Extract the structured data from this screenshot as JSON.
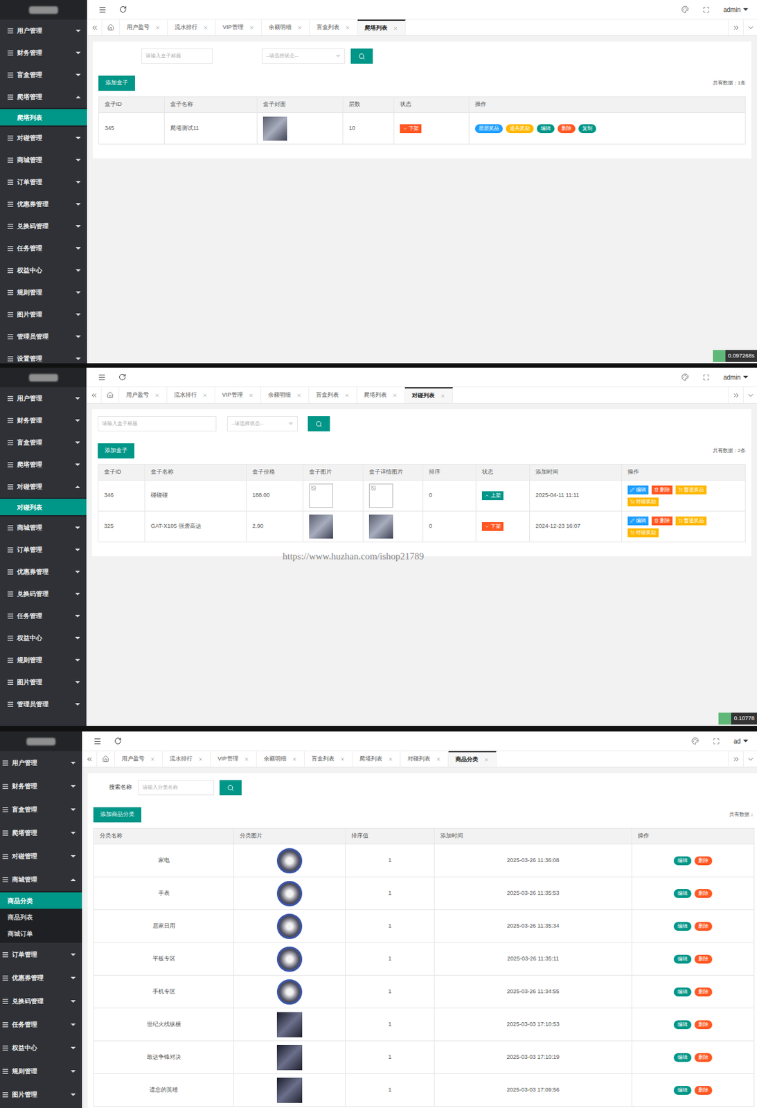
{
  "panels": [
    {
      "user": "admin",
      "sidebar": [
        {
          "label": "用户管理",
          "expanded": false,
          "children": []
        },
        {
          "label": "财务管理",
          "expanded": false,
          "children": []
        },
        {
          "label": "盲盒管理",
          "expanded": false,
          "children": []
        },
        {
          "label": "爬塔管理",
          "expanded": true,
          "children": [
            {
              "label": "爬塔列表",
              "selected": true
            }
          ]
        },
        {
          "label": "对碰管理",
          "expanded": false,
          "children": []
        },
        {
          "label": "商城管理",
          "expanded": false,
          "children": []
        },
        {
          "label": "订单管理",
          "expanded": false,
          "children": []
        },
        {
          "label": "优惠券管理",
          "expanded": false,
          "children": []
        },
        {
          "label": "兑换码管理",
          "expanded": false,
          "children": []
        },
        {
          "label": "任务管理",
          "expanded": false,
          "children": []
        },
        {
          "label": "权益中心",
          "expanded": false,
          "children": []
        },
        {
          "label": "规则管理",
          "expanded": false,
          "children": []
        },
        {
          "label": "图片管理",
          "expanded": false,
          "children": []
        },
        {
          "label": "管理员管理",
          "expanded": false,
          "children": []
        },
        {
          "label": "设置管理",
          "expanded": false,
          "children": []
        }
      ],
      "tabs": [
        {
          "label": "用户盈亏",
          "selected": false
        },
        {
          "label": "流水排行",
          "selected": false
        },
        {
          "label": "VIP管理",
          "selected": false
        },
        {
          "label": "余额明细",
          "selected": false
        },
        {
          "label": "盲盒列表",
          "selected": false
        },
        {
          "label": "爬塔列表",
          "selected": true
        }
      ],
      "search": {
        "label": "",
        "placeholder": "请输入盒子标题"
      },
      "select": {
        "placeholder": "--请选择状态--"
      },
      "add_button": "添加盒子",
      "count": "共有数据：1条",
      "table": {
        "columns": [
          "盒子ID",
          "盒子名称",
          "盒子封面",
          "层数",
          "状态",
          "操作"
        ],
        "rows": [
          {
            "cells": [
              {
                "kind": "text",
                "text": "345"
              },
              {
                "kind": "text",
                "text": "爬塔测试11"
              },
              {
                "kind": "image",
                "image": "photo"
              },
              {
                "kind": "text",
                "text": "10"
              },
              {
                "kind": "status",
                "label": "下架",
                "on": false
              },
              {
                "kind": "actions",
                "actions": [
                  {
                    "label": "层层奖品",
                    "kind": "pill",
                    "color": "#1e9fff"
                  },
                  {
                    "label": "通关奖励",
                    "kind": "pill",
                    "color": "#ffb800"
                  },
                  {
                    "label": "编辑",
                    "kind": "pill",
                    "color": "#009688"
                  },
                  {
                    "label": "删除",
                    "kind": "pill",
                    "color": "#ff5722"
                  },
                  {
                    "label": "复制",
                    "kind": "pill",
                    "color": "#009688"
                  }
                ]
              }
            ]
          }
        ]
      },
      "watermark": "",
      "timer": "0.097268s"
    },
    {
      "user": "admin",
      "sidebar": [
        {
          "label": "用户管理",
          "expanded": false,
          "children": []
        },
        {
          "label": "财务管理",
          "expanded": false,
          "children": []
        },
        {
          "label": "盲盒管理",
          "expanded": false,
          "children": []
        },
        {
          "label": "爬塔管理",
          "expanded": false,
          "children": []
        },
        {
          "label": "对碰管理",
          "expanded": true,
          "children": [
            {
              "label": "对碰列表",
              "selected": true
            }
          ]
        },
        {
          "label": "商城管理",
          "expanded": false,
          "children": []
        },
        {
          "label": "订单管理",
          "expanded": false,
          "children": []
        },
        {
          "label": "优惠券管理",
          "expanded": false,
          "children": []
        },
        {
          "label": "兑换码管理",
          "expanded": false,
          "children": []
        },
        {
          "label": "任务管理",
          "expanded": false,
          "children": []
        },
        {
          "label": "权益中心",
          "expanded": false,
          "children": []
        },
        {
          "label": "规则管理",
          "expanded": false,
          "children": []
        },
        {
          "label": "图片管理",
          "expanded": false,
          "children": []
        },
        {
          "label": "管理员管理",
          "expanded": false,
          "children": []
        }
      ],
      "tabs": [
        {
          "label": "用户盈亏",
          "selected": false
        },
        {
          "label": "流水排行",
          "selected": false
        },
        {
          "label": "VIP管理",
          "selected": false
        },
        {
          "label": "余额明细",
          "selected": false
        },
        {
          "label": "盲盒列表",
          "selected": false
        },
        {
          "label": "爬塔列表",
          "selected": false
        },
        {
          "label": "对碰列表",
          "selected": true
        }
      ],
      "search": {
        "label": "",
        "placeholder": "请输入盒子标题"
      },
      "select": {
        "placeholder": "--请选择状态--"
      },
      "add_button": "添加盒子",
      "count": "共有数据：2条",
      "table": {
        "columns": [
          "盒子ID",
          "盒子名称",
          "盒子价格",
          "盒子图片",
          "盒子详情图片",
          "排序",
          "状态",
          "添加时间",
          "操作"
        ],
        "rows": [
          {
            "cells": [
              {
                "kind": "text",
                "text": "346"
              },
              {
                "kind": "text",
                "text": "碰碰碰"
              },
              {
                "kind": "text",
                "text": "188.00"
              },
              {
                "kind": "image",
                "image": "broken"
              },
              {
                "kind": "image",
                "image": "broken"
              },
              {
                "kind": "text",
                "text": "0"
              },
              {
                "kind": "status",
                "label": "上架",
                "on": true
              },
              {
                "kind": "text",
                "text": "2025-04-11 11:11"
              },
              {
                "kind": "actions",
                "actions": [
                  {
                    "label": "编辑",
                    "kind": "edit",
                    "color": "#1e9fff"
                  },
                  {
                    "label": "删除",
                    "kind": "delete",
                    "color": "#ff5722"
                  },
                  {
                    "label": "普通奖品",
                    "kind": "prize",
                    "color": "#ffb800"
                  },
                  {
                    "label": "对碰奖励",
                    "kind": "prize",
                    "color": "#ffb800"
                  }
                ]
              }
            ]
          },
          {
            "cells": [
              {
                "kind": "text",
                "text": "325"
              },
              {
                "kind": "text",
                "text": "GAT-X105 强袭高达"
              },
              {
                "kind": "text",
                "text": "2.90"
              },
              {
                "kind": "image",
                "image": "photo"
              },
              {
                "kind": "image",
                "image": "photo"
              },
              {
                "kind": "text",
                "text": "0"
              },
              {
                "kind": "status",
                "label": "下架",
                "on": false
              },
              {
                "kind": "text",
                "text": "2024-12-23 16:07"
              },
              {
                "kind": "actions",
                "actions": [
                  {
                    "label": "编辑",
                    "kind": "edit",
                    "color": "#1e9fff"
                  },
                  {
                    "label": "删除",
                    "kind": "delete",
                    "color": "#ff5722"
                  },
                  {
                    "label": "普通奖品",
                    "kind": "prize",
                    "color": "#ffb800"
                  },
                  {
                    "label": "对碰奖励",
                    "kind": "prize",
                    "color": "#ffb800"
                  }
                ]
              }
            ]
          }
        ]
      },
      "watermark": "https://www.huzhan.com/ishop21789",
      "timer": "0.10778"
    },
    {
      "user": "ad",
      "sidebar": [
        {
          "label": "用户管理",
          "expanded": false,
          "children": []
        },
        {
          "label": "财务管理",
          "expanded": false,
          "children": []
        },
        {
          "label": "盲盒管理",
          "expanded": false,
          "children": []
        },
        {
          "label": "爬塔管理",
          "expanded": false,
          "children": []
        },
        {
          "label": "对碰管理",
          "expanded": false,
          "children": []
        },
        {
          "label": "商城管理",
          "expanded": true,
          "children": [
            {
              "label": "商品分类",
              "selected": true
            },
            {
              "label": "商品列表",
              "selected": false
            },
            {
              "label": "商城订单",
              "selected": false
            }
          ]
        },
        {
          "label": "订单管理",
          "expanded": false,
          "children": []
        },
        {
          "label": "优惠券管理",
          "expanded": false,
          "children": []
        },
        {
          "label": "兑换码管理",
          "expanded": false,
          "children": []
        },
        {
          "label": "任务管理",
          "expanded": false,
          "children": []
        },
        {
          "label": "权益中心",
          "expanded": false,
          "children": []
        },
        {
          "label": "规则管理",
          "expanded": false,
          "children": []
        },
        {
          "label": "图片管理",
          "expanded": false,
          "children": []
        }
      ],
      "tabs": [
        {
          "label": "用户盈亏",
          "selected": false
        },
        {
          "label": "流水排行",
          "selected": false
        },
        {
          "label": "VIP管理",
          "selected": false
        },
        {
          "label": "余额明细",
          "selected": false
        },
        {
          "label": "盲盒列表",
          "selected": false
        },
        {
          "label": "爬塔列表",
          "selected": false
        },
        {
          "label": "对碰列表",
          "selected": false
        },
        {
          "label": "商品分类",
          "selected": true
        }
      ],
      "search": {
        "label": "搜索名称",
        "placeholder": "请输入分类名称"
      },
      "select": null,
      "add_button": "添加商品分类",
      "count": "共有数据：",
      "table": {
        "columns": [
          "分类名称",
          "分类图片",
          "排序值",
          "添加时间",
          "操作"
        ],
        "rows": [
          {
            "cells": [
              {
                "kind": "text",
                "text": "家电"
              },
              {
                "kind": "image",
                "image": "circle"
              },
              {
                "kind": "text",
                "text": "1"
              },
              {
                "kind": "text",
                "text": "2025-03-26 11:36:08"
              },
              {
                "kind": "actions",
                "actions": [
                  {
                    "label": "编辑",
                    "kind": "pill",
                    "color": "#009688"
                  },
                  {
                    "label": "删除",
                    "kind": "pill",
                    "color": "#ff5722"
                  }
                ]
              }
            ]
          },
          {
            "cells": [
              {
                "kind": "text",
                "text": "手表"
              },
              {
                "kind": "image",
                "image": "circle"
              },
              {
                "kind": "text",
                "text": "1"
              },
              {
                "kind": "text",
                "text": "2025-03-26 11:35:53"
              },
              {
                "kind": "actions",
                "actions": [
                  {
                    "label": "编辑",
                    "kind": "pill",
                    "color": "#009688"
                  },
                  {
                    "label": "删除",
                    "kind": "pill",
                    "color": "#ff5722"
                  }
                ]
              }
            ]
          },
          {
            "cells": [
              {
                "kind": "text",
                "text": "居家日用"
              },
              {
                "kind": "image",
                "image": "circle"
              },
              {
                "kind": "text",
                "text": "1"
              },
              {
                "kind": "text",
                "text": "2025-03-26 11:35:34"
              },
              {
                "kind": "actions",
                "actions": [
                  {
                    "label": "编辑",
                    "kind": "pill",
                    "color": "#009688"
                  },
                  {
                    "label": "删除",
                    "kind": "pill",
                    "color": "#ff5722"
                  }
                ]
              }
            ]
          },
          {
            "cells": [
              {
                "kind": "text",
                "text": "平板专区"
              },
              {
                "kind": "image",
                "image": "circle"
              },
              {
                "kind": "text",
                "text": "1"
              },
              {
                "kind": "text",
                "text": "2025-03-26 11:35:11"
              },
              {
                "kind": "actions",
                "actions": [
                  {
                    "label": "编辑",
                    "kind": "pill",
                    "color": "#009688"
                  },
                  {
                    "label": "删除",
                    "kind": "pill",
                    "color": "#ff5722"
                  }
                ]
              }
            ]
          },
          {
            "cells": [
              {
                "kind": "text",
                "text": "手机专区"
              },
              {
                "kind": "image",
                "image": "circle"
              },
              {
                "kind": "text",
                "text": "1"
              },
              {
                "kind": "text",
                "text": "2025-03-26 11:34:55"
              },
              {
                "kind": "actions",
                "actions": [
                  {
                    "label": "编辑",
                    "kind": "pill",
                    "color": "#009688"
                  },
                  {
                    "label": "删除",
                    "kind": "pill",
                    "color": "#ff5722"
                  }
                ]
              }
            ]
          },
          {
            "cells": [
              {
                "kind": "text",
                "text": "世纪火线纵横"
              },
              {
                "kind": "image",
                "image": "square"
              },
              {
                "kind": "text",
                "text": "1"
              },
              {
                "kind": "text",
                "text": "2025-03-03 17:10:53"
              },
              {
                "kind": "actions",
                "actions": [
                  {
                    "label": "编辑",
                    "kind": "pill",
                    "color": "#009688"
                  },
                  {
                    "label": "删除",
                    "kind": "pill",
                    "color": "#ff5722"
                  }
                ]
              }
            ]
          },
          {
            "cells": [
              {
                "kind": "text",
                "text": "敢达争锋对决"
              },
              {
                "kind": "image",
                "image": "square"
              },
              {
                "kind": "text",
                "text": "1"
              },
              {
                "kind": "text",
                "text": "2025-03-03 17:10:19"
              },
              {
                "kind": "actions",
                "actions": [
                  {
                    "label": "编辑",
                    "kind": "pill",
                    "color": "#009688"
                  },
                  {
                    "label": "删除",
                    "kind": "pill",
                    "color": "#ff5722"
                  }
                ]
              }
            ]
          },
          {
            "cells": [
              {
                "kind": "text",
                "text": "遗忘的英雄"
              },
              {
                "kind": "image",
                "image": "square"
              },
              {
                "kind": "text",
                "text": "1"
              },
              {
                "kind": "text",
                "text": "2025-03-03 17:09:56"
              },
              {
                "kind": "actions",
                "actions": [
                  {
                    "label": "编辑",
                    "kind": "pill",
                    "color": "#009688"
                  },
                  {
                    "label": "删除",
                    "kind": "pill",
                    "color": "#ff5722"
                  }
                ]
              }
            ]
          }
        ]
      },
      "watermark": "",
      "timer": ""
    }
  ]
}
